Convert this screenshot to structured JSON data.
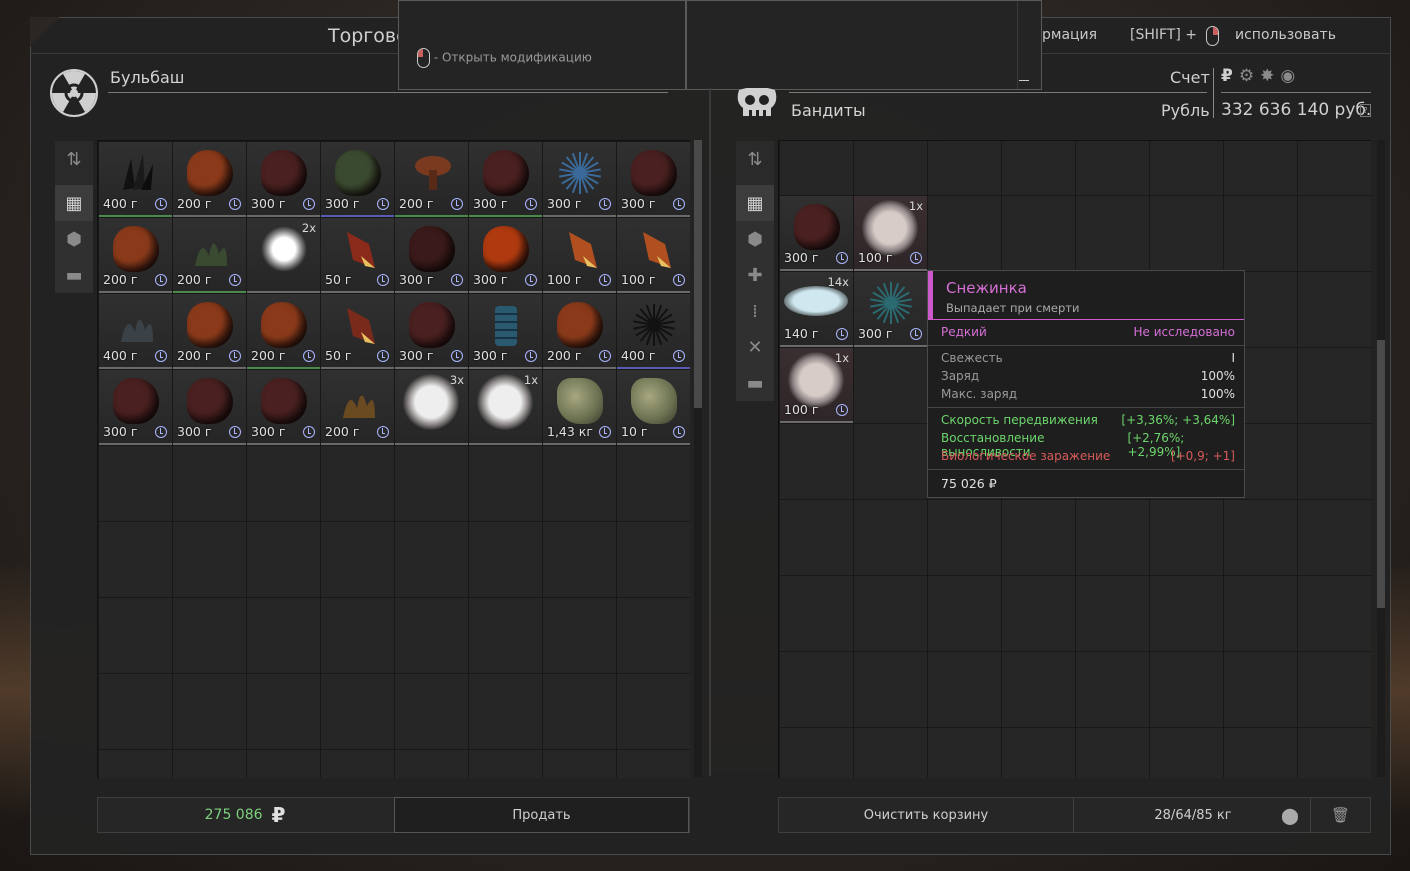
{
  "top": {
    "title": "Торгове",
    "hint_info": "рмация",
    "hint_shift": "[SHIFT] +",
    "hint_use": "использовать",
    "overlay_hint": "- Открыть модификацию"
  },
  "left": {
    "trader_name": "Бульбаш",
    "money": "275 086",
    "currency_icon": "₽",
    "sell_label": "Продать",
    "items": [
      {
        "w": "400 г",
        "c": "#262626",
        "s": "crystal",
        "b": "green"
      },
      {
        "w": "200 г",
        "c": "#8a3a1a",
        "s": "rock",
        "b": "grey"
      },
      {
        "w": "300 г",
        "c": "#4a2020",
        "s": "rock",
        "b": "grey"
      },
      {
        "w": "300 г",
        "c": "#3a4a30",
        "s": "rock",
        "b": "blue"
      },
      {
        "w": "200 г",
        "c": "#7a3a20",
        "s": "mush",
        "b": "green"
      },
      {
        "w": "300 г",
        "c": "#4a2020",
        "s": "rock",
        "b": "green"
      },
      {
        "w": "300 г",
        "c": "#3a6a9a",
        "s": "star",
        "b": "grey"
      },
      {
        "w": "300 г",
        "c": "#4a2020",
        "s": "rock",
        "b": "grey"
      },
      {
        "w": "200 г",
        "c": "#8a3a1a",
        "s": "rock",
        "b": "grey"
      },
      {
        "w": "200 г",
        "c": "#3a4a30",
        "s": "plant",
        "b": "green"
      },
      {
        "w": "",
        "c": "#f0f0f0",
        "s": "glow",
        "b": "grey",
        "n": "2x"
      },
      {
        "w": "50 г",
        "c": "#8a2a1a",
        "s": "shard",
        "b": "grey"
      },
      {
        "w": "300 г",
        "c": "#3a1a1a",
        "s": "rock",
        "b": "grey"
      },
      {
        "w": "300 г",
        "c": "#b03a10",
        "s": "rock",
        "b": "grey"
      },
      {
        "w": "100 г",
        "c": "#b05020",
        "s": "shard",
        "b": "grey"
      },
      {
        "w": "100 г",
        "c": "#b05020",
        "s": "shard",
        "b": "grey"
      },
      {
        "w": "400 г",
        "c": "#3a4248",
        "s": "plant",
        "b": "grey"
      },
      {
        "w": "200 г",
        "c": "#8a3a1a",
        "s": "rock",
        "b": "grey"
      },
      {
        "w": "200 г",
        "c": "#8a3a1a",
        "s": "rock",
        "b": "green"
      },
      {
        "w": "50 г",
        "c": "#7a2a1a",
        "s": "shard",
        "b": "grey"
      },
      {
        "w": "300 г",
        "c": "#4a2020",
        "s": "rock",
        "b": "grey"
      },
      {
        "w": "300 г",
        "c": "#2a5a70",
        "s": "cyl",
        "b": "grey"
      },
      {
        "w": "200 г",
        "c": "#8a3a1a",
        "s": "rock",
        "b": "grey"
      },
      {
        "w": "400 г",
        "c": "#111111",
        "s": "star",
        "b": "blue"
      },
      {
        "w": "300 г",
        "c": "#4a2020",
        "s": "rock",
        "b": "grey"
      },
      {
        "w": "300 г",
        "c": "#4a2020",
        "s": "rock",
        "b": "grey"
      },
      {
        "w": "300 г",
        "c": "#4a2020",
        "s": "rock",
        "b": "grey"
      },
      {
        "w": "200 г",
        "c": "#6a4a20",
        "s": "plant",
        "b": "grey"
      },
      {
        "w": "",
        "c": "#eeeeee",
        "s": "cloud",
        "b": "grey",
        "n": "3x"
      },
      {
        "w": "",
        "c": "#eeeeee",
        "s": "cloud",
        "b": "grey",
        "n": "1x"
      },
      {
        "w": "1,43 кг",
        "c": "#6a7050",
        "s": "lump",
        "b": "grey"
      },
      {
        "w": "10 г",
        "c": "#6a7050",
        "s": "lump",
        "b": "grey"
      }
    ]
  },
  "right": {
    "faction_name": "Бандиты",
    "account_label": "Счет",
    "currency_label": "Рубль",
    "balance": "332 636 140 руб.",
    "currency_icons": [
      "₽",
      "⚙",
      "✸",
      "◉"
    ],
    "clear_cart_label": "Очистить корзину",
    "weight": "28/64/85 кг",
    "items": [
      {
        "w": "300 г",
        "c": "#4a2020",
        "s": "rock",
        "b": "grey",
        "col": 0,
        "row": 1
      },
      {
        "w": "100 г",
        "c": "#d8ccc8",
        "s": "cloud",
        "b": "grey",
        "col": 1,
        "row": 1,
        "n": "1x",
        "pink": true
      },
      {
        "w": "140 г",
        "c": "#cfe8f0",
        "s": "snow",
        "b": "grey",
        "col": 0,
        "row": 2,
        "n": "14x"
      },
      {
        "w": "300 г",
        "c": "#2a6a70",
        "s": "star",
        "b": "grey",
        "col": 1,
        "row": 2
      },
      {
        "w": "100 г",
        "c": "#d8ccc8",
        "s": "cloud",
        "b": "grey",
        "col": 0,
        "row": 3,
        "n": "1x",
        "pink": true
      }
    ]
  },
  "tooltip": {
    "title": "Снежинка",
    "subtitle": "Выпадает при смерти",
    "rarity": "Редкий",
    "research": "Не исследовано",
    "stats": [
      {
        "label": "Свежесть",
        "value": "I"
      },
      {
        "label": "Заряд",
        "value": "100%"
      },
      {
        "label": "Макс. заряд",
        "value": "100%"
      }
    ],
    "effects": [
      {
        "label": "Скорость передвижения",
        "value": "[+3,36%; +3,64%]",
        "color": "#6cd66c"
      },
      {
        "label": "Восстановление выносливости",
        "value": "[+2,76%; +2,99%]",
        "color": "#6cd66c"
      },
      {
        "label": "Биологическое заражение",
        "value": "[+0,9; +1]",
        "color": "#d65a5a"
      }
    ],
    "price": "75 026 ₽"
  }
}
